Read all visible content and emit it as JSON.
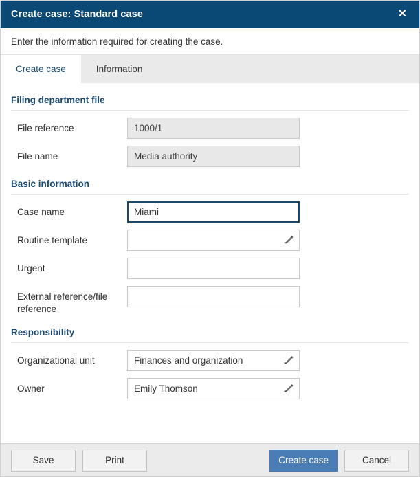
{
  "dialog": {
    "title": "Create case: Standard case",
    "close_icon": "close-icon",
    "subtitle": "Enter the information required for creating the case."
  },
  "tabs": [
    {
      "label": "Create case",
      "active": true
    },
    {
      "label": "Information",
      "active": false
    }
  ],
  "sections": [
    {
      "header": "Filing department file",
      "fields": [
        {
          "label": "File reference",
          "value": "1000/1",
          "readonly": true,
          "focused": false,
          "pencil": false
        },
        {
          "label": "File name",
          "value": "Media authority",
          "readonly": true,
          "focused": false,
          "pencil": false
        }
      ]
    },
    {
      "header": "Basic information",
      "fields": [
        {
          "label": "Case name",
          "value": "Miami",
          "readonly": false,
          "focused": true,
          "pencil": false
        },
        {
          "label": "Routine template",
          "value": "",
          "readonly": false,
          "focused": false,
          "pencil": true
        },
        {
          "label": "Urgent",
          "value": "",
          "readonly": false,
          "focused": false,
          "pencil": false
        },
        {
          "label": "External reference/file reference",
          "value": "",
          "readonly": false,
          "focused": false,
          "pencil": false
        }
      ]
    },
    {
      "header": "Responsibility",
      "fields": [
        {
          "label": "Organizational unit",
          "value": "Finances and organization",
          "readonly": false,
          "focused": false,
          "pencil": true
        },
        {
          "label": "Owner",
          "value": "Emily Thomson",
          "readonly": false,
          "focused": false,
          "pencil": true
        }
      ]
    }
  ],
  "footer": {
    "left_buttons": [
      {
        "label": "Save",
        "primary": false
      },
      {
        "label": "Print",
        "primary": false
      }
    ],
    "right_buttons": [
      {
        "label": "Create case",
        "primary": true
      },
      {
        "label": "Cancel",
        "primary": false
      }
    ]
  },
  "colors": {
    "titlebar": "#0a4875",
    "section_header": "#1b4a72",
    "primary_button": "#4a7db5",
    "focus_border": "#19486f",
    "readonly_field": "#e8e8e8",
    "footer_bg": "#ebebeb",
    "inactive_tab": "#eaeaea"
  }
}
